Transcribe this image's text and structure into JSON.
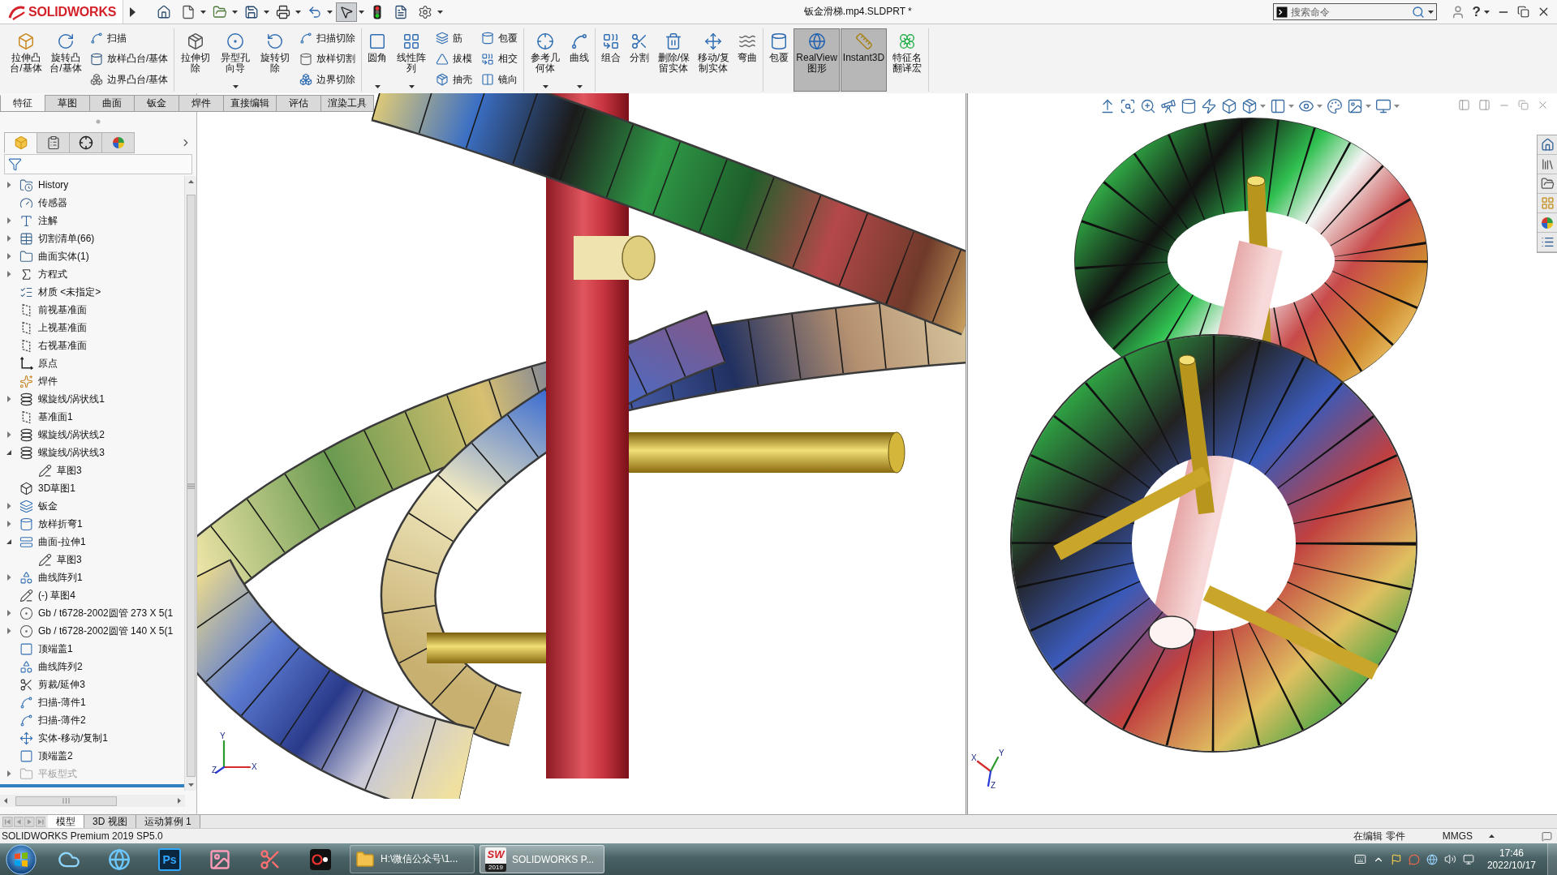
{
  "title_bar": {
    "logo": "SOLIDWORKS",
    "title": "钣金滑梯.mp4.SLDPRT *",
    "search": {
      "placeholder": "搜索命令"
    },
    "help": "?"
  },
  "quick_access": [
    {
      "dropdown": false,
      "pressed": false
    },
    {
      "dropdown": true,
      "pressed": false
    },
    {
      "dropdown": true,
      "pressed": false
    },
    {
      "dropdown": true,
      "pressed": false
    },
    {
      "dropdown": true,
      "pressed": false
    },
    {
      "dropdown": true,
      "pressed": false
    },
    {
      "dropdown": true,
      "pressed": true
    },
    {
      "dropdown": false,
      "pressed": false
    },
    {
      "dropdown": false,
      "pressed": false
    },
    {
      "dropdown": true,
      "pressed": false
    }
  ],
  "command_manager": {
    "groups": [
      {
        "columns": [
          {
            "kind": "large",
            "label": "拉伸凸台/基体",
            "dropdown": false,
            "pressed": false
          },
          {
            "kind": "large",
            "label": "旋转凸台/基体",
            "dropdown": false,
            "pressed": false
          },
          {
            "kind": "stack",
            "items": [
              {
                "label": "扫描"
              },
              {
                "label": "放样凸台/基体"
              },
              {
                "label": "边界凸台/基体"
              }
            ]
          }
        ]
      },
      {
        "columns": [
          {
            "kind": "large",
            "label": "拉伸切除",
            "dropdown": false,
            "pressed": false
          },
          {
            "kind": "large",
            "label": "异型孔向导",
            "dropdown": true,
            "pressed": false
          },
          {
            "kind": "large",
            "label": "旋转切除",
            "dropdown": false,
            "pressed": false
          },
          {
            "kind": "stack",
            "items": [
              {
                "label": "扫描切除"
              },
              {
                "label": "放样切割"
              },
              {
                "label": "边界切除"
              }
            ]
          }
        ]
      },
      {
        "columns": [
          {
            "kind": "large",
            "label": "圆角",
            "dropdown": true,
            "pressed": false
          },
          {
            "kind": "large",
            "label": "线性阵列",
            "dropdown": true,
            "pressed": false
          },
          {
            "kind": "stack",
            "items": [
              {
                "label": "筋"
              },
              {
                "label": "拔模"
              },
              {
                "label": "抽壳"
              }
            ]
          },
          {
            "kind": "stack",
            "items": [
              {
                "label": "包覆"
              },
              {
                "label": "相交"
              },
              {
                "label": "镜向"
              }
            ]
          }
        ]
      },
      {
        "columns": [
          {
            "kind": "large",
            "label": "参考几何体",
            "dropdown": true,
            "pressed": false
          },
          {
            "kind": "large",
            "label": "曲线",
            "dropdown": true,
            "pressed": false
          }
        ]
      },
      {
        "columns": [
          {
            "kind": "large",
            "label": "组合",
            "dropdown": false,
            "pressed": false
          },
          {
            "kind": "large",
            "label": "分割",
            "dropdown": false,
            "pressed": false
          },
          {
            "kind": "large",
            "label": "删除/保留实体",
            "dropdown": false,
            "pressed": false
          },
          {
            "kind": "large",
            "label": "移动/复制实体",
            "dropdown": false,
            "pressed": false
          },
          {
            "kind": "large",
            "label": "弯曲",
            "dropdown": false,
            "pressed": false
          }
        ]
      },
      {
        "columns": [
          {
            "kind": "large",
            "label": "包覆",
            "dropdown": false,
            "pressed": false
          },
          {
            "kind": "large",
            "label": "RealView 图形",
            "dropdown": false,
            "pressed": true
          },
          {
            "kind": "large",
            "label": "Instant3D",
            "dropdown": false,
            "pressed": true
          },
          {
            "kind": "large",
            "label": "特征名翻译宏",
            "dropdown": false,
            "pressed": false
          }
        ]
      }
    ],
    "tabs": [
      {
        "label": "特征",
        "selected": true
      },
      {
        "label": "草图",
        "selected": false
      },
      {
        "label": "曲面",
        "selected": false
      },
      {
        "label": "钣金",
        "selected": false
      },
      {
        "label": "焊件",
        "selected": false
      },
      {
        "label": "直接编辑",
        "selected": false
      },
      {
        "label": "评估",
        "selected": false
      },
      {
        "label": "渲染工具",
        "selected": false
      }
    ]
  },
  "feature_manager": {
    "tabs": [
      {
        "selected": true
      },
      {
        "selected": false
      },
      {
        "selected": false
      },
      {
        "selected": false
      }
    ]
  },
  "feature_tree": {
    "items": [
      {
        "label": "History",
        "kind": "history",
        "expanded": false,
        "disabled": false
      },
      {
        "label": "传感器",
        "kind": "sensors",
        "disabled": false
      },
      {
        "label": "注解",
        "kind": "annotations",
        "expanded": false,
        "disabled": false
      },
      {
        "label": "切割清单(66)",
        "kind": "cutlist",
        "expanded": false,
        "disabled": false
      },
      {
        "label": "曲面实体(1)",
        "kind": "bodies",
        "expanded": false,
        "disabled": false
      },
      {
        "label": "方程式",
        "kind": "equations",
        "expanded": false,
        "disabled": false
      },
      {
        "label": "材质 <未指定>",
        "kind": "material",
        "disabled": false
      },
      {
        "label": "前视基准面",
        "kind": "plane",
        "disabled": false
      },
      {
        "label": "上视基准面",
        "kind": "plane",
        "disabled": false
      },
      {
        "label": "右视基准面",
        "kind": "plane",
        "disabled": false
      },
      {
        "label": "原点",
        "kind": "origin",
        "disabled": false
      },
      {
        "label": "焊件",
        "kind": "weldment",
        "disabled": false
      },
      {
        "label": "螺旋线/涡状线1",
        "kind": "helix",
        "expanded": false,
        "disabled": false
      },
      {
        "label": "基准面1",
        "kind": "plane",
        "disabled": false
      },
      {
        "label": "螺旋线/涡状线2",
        "kind": "helix",
        "expanded": false,
        "disabled": false
      },
      {
        "label": "螺旋线/涡状线3",
        "kind": "helix",
        "expanded": true,
        "disabled": false,
        "children": [
          {
            "label": "草图3",
            "kind": "sketch",
            "disabled": false
          }
        ]
      },
      {
        "label": "3D草图1",
        "kind": "sketch3d",
        "disabled": false
      },
      {
        "label": "钣金",
        "kind": "sheetmetal",
        "expanded": false,
        "disabled": false
      },
      {
        "label": "放样折弯1",
        "kind": "loftbend",
        "expanded": false,
        "disabled": false
      },
      {
        "label": "曲面-拉伸1",
        "kind": "extrude",
        "expanded": true,
        "disabled": false,
        "children": [
          {
            "label": "草图3",
            "kind": "sketch",
            "disabled": false
          }
        ]
      },
      {
        "label": "曲线阵列1",
        "kind": "pattern",
        "expanded": false,
        "disabled": false
      },
      {
        "label": "(-) 草图4",
        "kind": "sketch",
        "disabled": false
      },
      {
        "label": "Gb / t6728-2002圆管 273 X 5(1",
        "kind": "member",
        "expanded": false,
        "disabled": false
      },
      {
        "label": "Gb / t6728-2002圆管 140 X 5(1",
        "kind": "member",
        "expanded": false,
        "disabled": false
      },
      {
        "label": "顶端盖1",
        "kind": "endcap",
        "disabled": false
      },
      {
        "label": "曲线阵列2",
        "kind": "pattern",
        "disabled": false
      },
      {
        "label": "剪裁/延伸3",
        "kind": "trim",
        "disabled": false
      },
      {
        "label": "扫描-薄件1",
        "kind": "sweep",
        "disabled": false
      },
      {
        "label": "扫描-薄件2",
        "kind": "sweep",
        "disabled": false
      },
      {
        "label": "实体-移动/复制1",
        "kind": "move",
        "disabled": false
      },
      {
        "label": "顶端盖2",
        "kind": "endcap",
        "disabled": false
      },
      {
        "label": "平板型式",
        "kind": "flat",
        "expanded": false,
        "disabled": true
      }
    ]
  },
  "viewports": [
    {
      "kind": "front",
      "active": false,
      "triad": [
        "Y",
        "X",
        "Z"
      ]
    },
    {
      "kind": "top",
      "active": true,
      "triad": [
        "X",
        "Y",
        "Z"
      ]
    }
  ],
  "heads_up_toolbar": [
    {
      "dropdown": false
    },
    {
      "dropdown": false
    },
    {
      "dropdown": false
    },
    {
      "dropdown": false
    },
    {
      "dropdown": false
    },
    {
      "dropdown": false
    },
    {
      "dropdown": false
    },
    {
      "dropdown": true
    },
    {
      "dropdown": true
    },
    {
      "dropdown": true
    },
    {
      "dropdown": false
    },
    {
      "dropdown": true
    },
    {
      "dropdown": true
    }
  ],
  "model_tabs": [
    {
      "label": "模型",
      "selected": true
    },
    {
      "label": "3D 视图",
      "selected": false
    },
    {
      "label": "运动算例 1",
      "selected": false
    }
  ],
  "status_bar": {
    "product": "SOLIDWORKS Premium 2019 SP5.0",
    "mode": "在编辑 零件",
    "units": "MMGS"
  },
  "taskbar": {
    "pinned": [
      {
        "kind": "netdisk"
      },
      {
        "kind": "browser"
      },
      {
        "kind": "photoshop",
        "label": "Ps"
      },
      {
        "kind": "gallery"
      },
      {
        "kind": "paint"
      },
      {
        "kind": "recorder"
      }
    ],
    "tasks": [
      {
        "kind": "folder",
        "label": "H:\\微信公众号\\1...",
        "selected": false
      },
      {
        "kind": "solidworks",
        "label": "SOLIDWORKS P...",
        "icon_text": "SW",
        "icon_year": "2019",
        "selected": true
      }
    ],
    "time": "17:46",
    "date": "2022/10/17"
  }
}
